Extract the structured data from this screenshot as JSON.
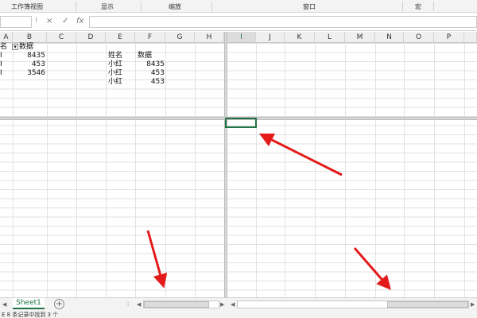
{
  "ribbon": {
    "groups": [
      "工作簿视图",
      "显示",
      "缩放",
      "窗口",
      "宏"
    ]
  },
  "formula_bar": {
    "cancel_icon": "×",
    "enter_icon": "✓",
    "fx_label": "fx",
    "content": ""
  },
  "columns_left": [
    "A",
    "B",
    "C",
    "D",
    "E",
    "F",
    "G",
    "H"
  ],
  "columns_right": [
    "I",
    "J",
    "K",
    "L",
    "M",
    "N",
    "O",
    "P"
  ],
  "left_table": {
    "header": [
      "名",
      "数据"
    ],
    "rows": [
      [
        "I",
        "8435"
      ],
      [
        "I",
        "453"
      ],
      [
        "I",
        "3546"
      ]
    ]
  },
  "right_table": {
    "header": [
      "姓名",
      "数据"
    ],
    "rows": [
      [
        "小红",
        "8435"
      ],
      [
        "小红",
        "453"
      ],
      [
        "小红",
        "453"
      ]
    ]
  },
  "sheet_tab": "Sheet1",
  "add_sheet": "+",
  "status_text": "E 8 条记录中找到 3 个",
  "colors": {
    "accent": "#217346",
    "arrow": "#e31b1b"
  }
}
